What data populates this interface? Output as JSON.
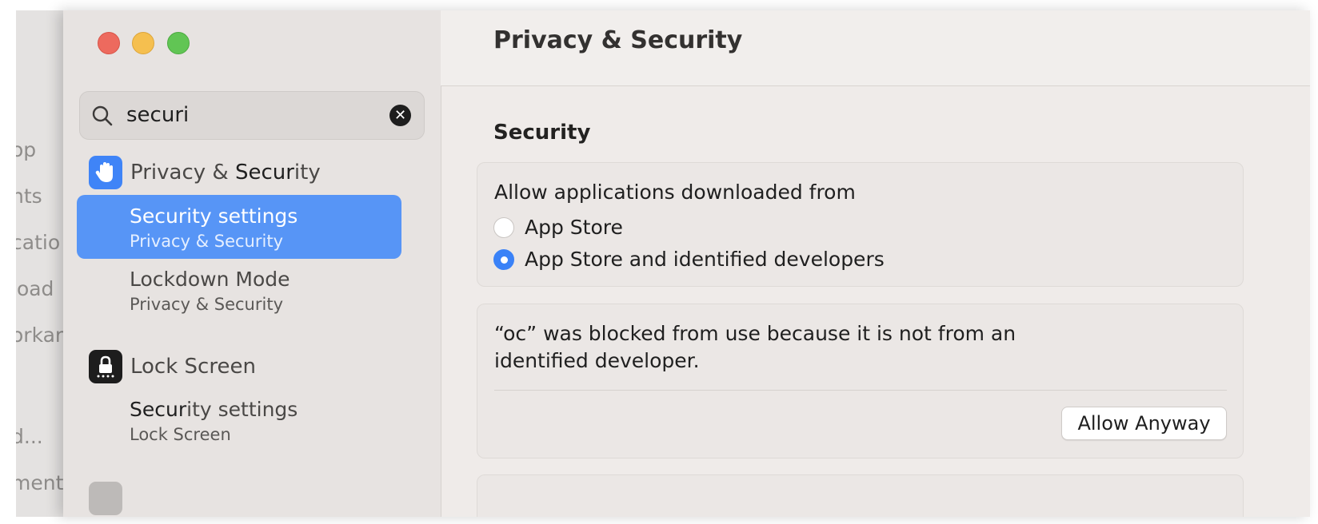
{
  "background_window": {
    "items": [
      "op",
      "nts",
      "catio",
      "load",
      "orkar",
      "d...",
      "ment"
    ]
  },
  "search": {
    "value": "securi"
  },
  "sidebar": {
    "sections": [
      {
        "title_prefix": "Privacy & ",
        "title_match": "Secur",
        "title_suffix": "ity",
        "icon": "hand-raised-icon",
        "results": [
          {
            "match": "Secur",
            "rest": "ity settings",
            "sub": "Privacy & Security",
            "selected": true
          },
          {
            "match": "",
            "rest": "Lockdown Mode",
            "sub": "Privacy & Security",
            "selected": false
          }
        ]
      },
      {
        "title_prefix": "Lock Screen",
        "title_match": "",
        "title_suffix": "",
        "icon": "lock-screen-icon",
        "results": [
          {
            "match": "Secur",
            "rest": "ity settings",
            "sub": "Lock Screen",
            "selected": false
          }
        ]
      }
    ]
  },
  "content": {
    "title": "Privacy & Security",
    "section_label": "Security",
    "allow_downloads": {
      "label": "Allow applications downloaded from",
      "options": [
        {
          "label": "App Store",
          "selected": false
        },
        {
          "label": "App Store and identified developers",
          "selected": true
        }
      ]
    },
    "blocked": {
      "line1": "“oc” was blocked from use because it is not from an",
      "line2": "identified developer.",
      "button_label": "Allow Anyway"
    }
  },
  "colors": {
    "accent": "#3a82f7",
    "selection": "#5795f6"
  }
}
